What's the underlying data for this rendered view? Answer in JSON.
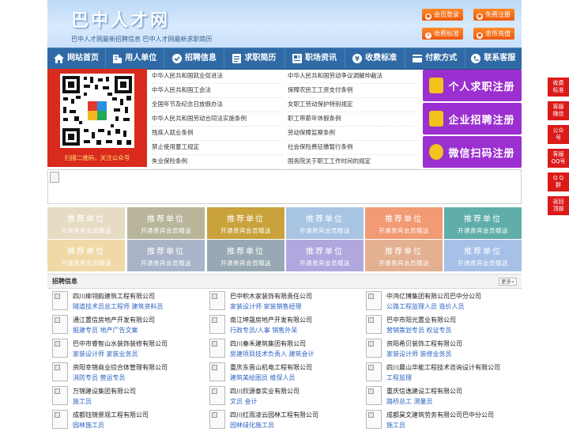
{
  "header": {
    "logo": "巴中人才网",
    "tagline": "巴中人才网最新招聘信息    巴中人才网最新求职简历",
    "buttons": [
      {
        "label": "会员登录",
        "icon": "user-icon"
      },
      {
        "label": "免费注册",
        "icon": "register-icon"
      },
      {
        "label": "收费标准",
        "icon": "price-icon"
      },
      {
        "label": "金币充值",
        "icon": "coin-icon"
      }
    ]
  },
  "nav": [
    {
      "label": "网站首页",
      "icon": "home-icon"
    },
    {
      "label": "用人单位",
      "icon": "building-icon"
    },
    {
      "label": "招聘信息",
      "icon": "hiring-icon"
    },
    {
      "label": "求职简历",
      "icon": "resume-icon"
    },
    {
      "label": "职场资讯",
      "icon": "news-icon"
    },
    {
      "label": "收费标准",
      "icon": "price-icon"
    },
    {
      "label": "付款方式",
      "icon": "payment-icon"
    },
    {
      "label": "联系客服",
      "icon": "phone-icon"
    }
  ],
  "qr": {
    "caption": "扫描二维码，关注公众号"
  },
  "laws": {
    "left": [
      "中华人民共和国就业促进法",
      "中华人民共和国工会法",
      "全国年节及纪念日放假办法",
      "中华人民共和国劳动合同法实施条例",
      "残疾人就业条例",
      "禁止使用童工规定",
      "失业保险条例"
    ],
    "right": [
      "中华人民共和国劳动争议调解仲裁法",
      "保障农民工工资支付条例",
      "女职工劳动保护特别规定",
      "职工带薪年休假条例",
      "劳动保障监察条例",
      "社会保险费征缴暂行条例",
      "国务院关于职工工作时间的规定"
    ]
  },
  "register": [
    "个人求职注册",
    "企业招聘注册",
    "微信扫码注册"
  ],
  "recommend": {
    "title": "推荐单位",
    "subtitle": "开通贵宾会员赠送",
    "colors": [
      "#e6dcc4",
      "#b9b59b",
      "#c9a23b",
      "#a8c4e3",
      "#f29a74",
      "#5faeaa",
      "#f0d9a7",
      "#a9b4c9",
      "#98a9b5",
      "#b1a7de",
      "#e3b091",
      "#a7c0e8"
    ]
  },
  "jobs": {
    "title": "招聘信息",
    "more": "更多»",
    "columns": [
      [
        {
          "company": "四川柳翎韵建筑工程有限公司",
          "positions": "隧道技术员总工程师 建筑资料员"
        },
        {
          "company": "通江置信房地产开发有限公司",
          "positions": "报建专员 地产广告文案"
        },
        {
          "company": "巴中市睿智山水装饰装修有限公司",
          "positions": "家装设计师 家装业务员"
        },
        {
          "company": "资阳幸锦商业综合体管理有限公司",
          "positions": "消防专员 营运专员"
        },
        {
          "company": "万锦建设集团有限公司",
          "positions": "施工员"
        },
        {
          "company": "成都钰锦景观工程有限公司",
          "positions": "园林施工员"
        }
      ],
      [
        {
          "company": "巴中积木家装饰有限责任公司",
          "positions": "家装设计师 家装销售经理"
        },
        {
          "company": "南江坤晟房地产开发有限公司",
          "positions": "行政专员/人事 销售外呆"
        },
        {
          "company": "四川秦禾建筑集团有限公司",
          "positions": "房建项目技术负责人 建筑会计"
        },
        {
          "company": "重庆东晋山机电工程有限公司",
          "positions": "建筑美绘图员 维保人员"
        },
        {
          "company": "四川欣源泰实业有限公司",
          "positions": "文员 会计"
        },
        {
          "company": "四川红雨凌云园林工程有限公司",
          "positions": "园林绿化施工员"
        }
      ],
      [
        {
          "company": "中鸿亿博集团有限公司巴中分公司",
          "positions": "公路工程监理人员 造价人员"
        },
        {
          "company": "巴中市阳光置业有限公司",
          "positions": "营销策划专员 权证专员"
        },
        {
          "company": "资阳希贝装饰工程有限公司",
          "positions": "家装设计师 装修业务员"
        },
        {
          "company": "四川晨山华能工程技术咨询设计有限公司",
          "positions": "工程监理"
        },
        {
          "company": "重庆信逸建设工程有限公司",
          "positions": "路桥总工 测量员"
        },
        {
          "company": "成都昊文建筑劳务有限公司巴中分公司",
          "positions": "施工员"
        }
      ]
    ]
  },
  "sidebar": [
    "收费\n标准",
    "客服\n微信",
    "公众\n号",
    "客服\nQQ号",
    "Q Q\n群",
    "返回\n顶部"
  ],
  "colors": {
    "nav_bg": "#2f6aa6",
    "accent_orange": "#f0580c",
    "register_purple": "#9b2fcf",
    "qr_red": "#d92a1e",
    "sidebar_red": "#dc1a1a",
    "link_blue": "#2a62c2"
  }
}
